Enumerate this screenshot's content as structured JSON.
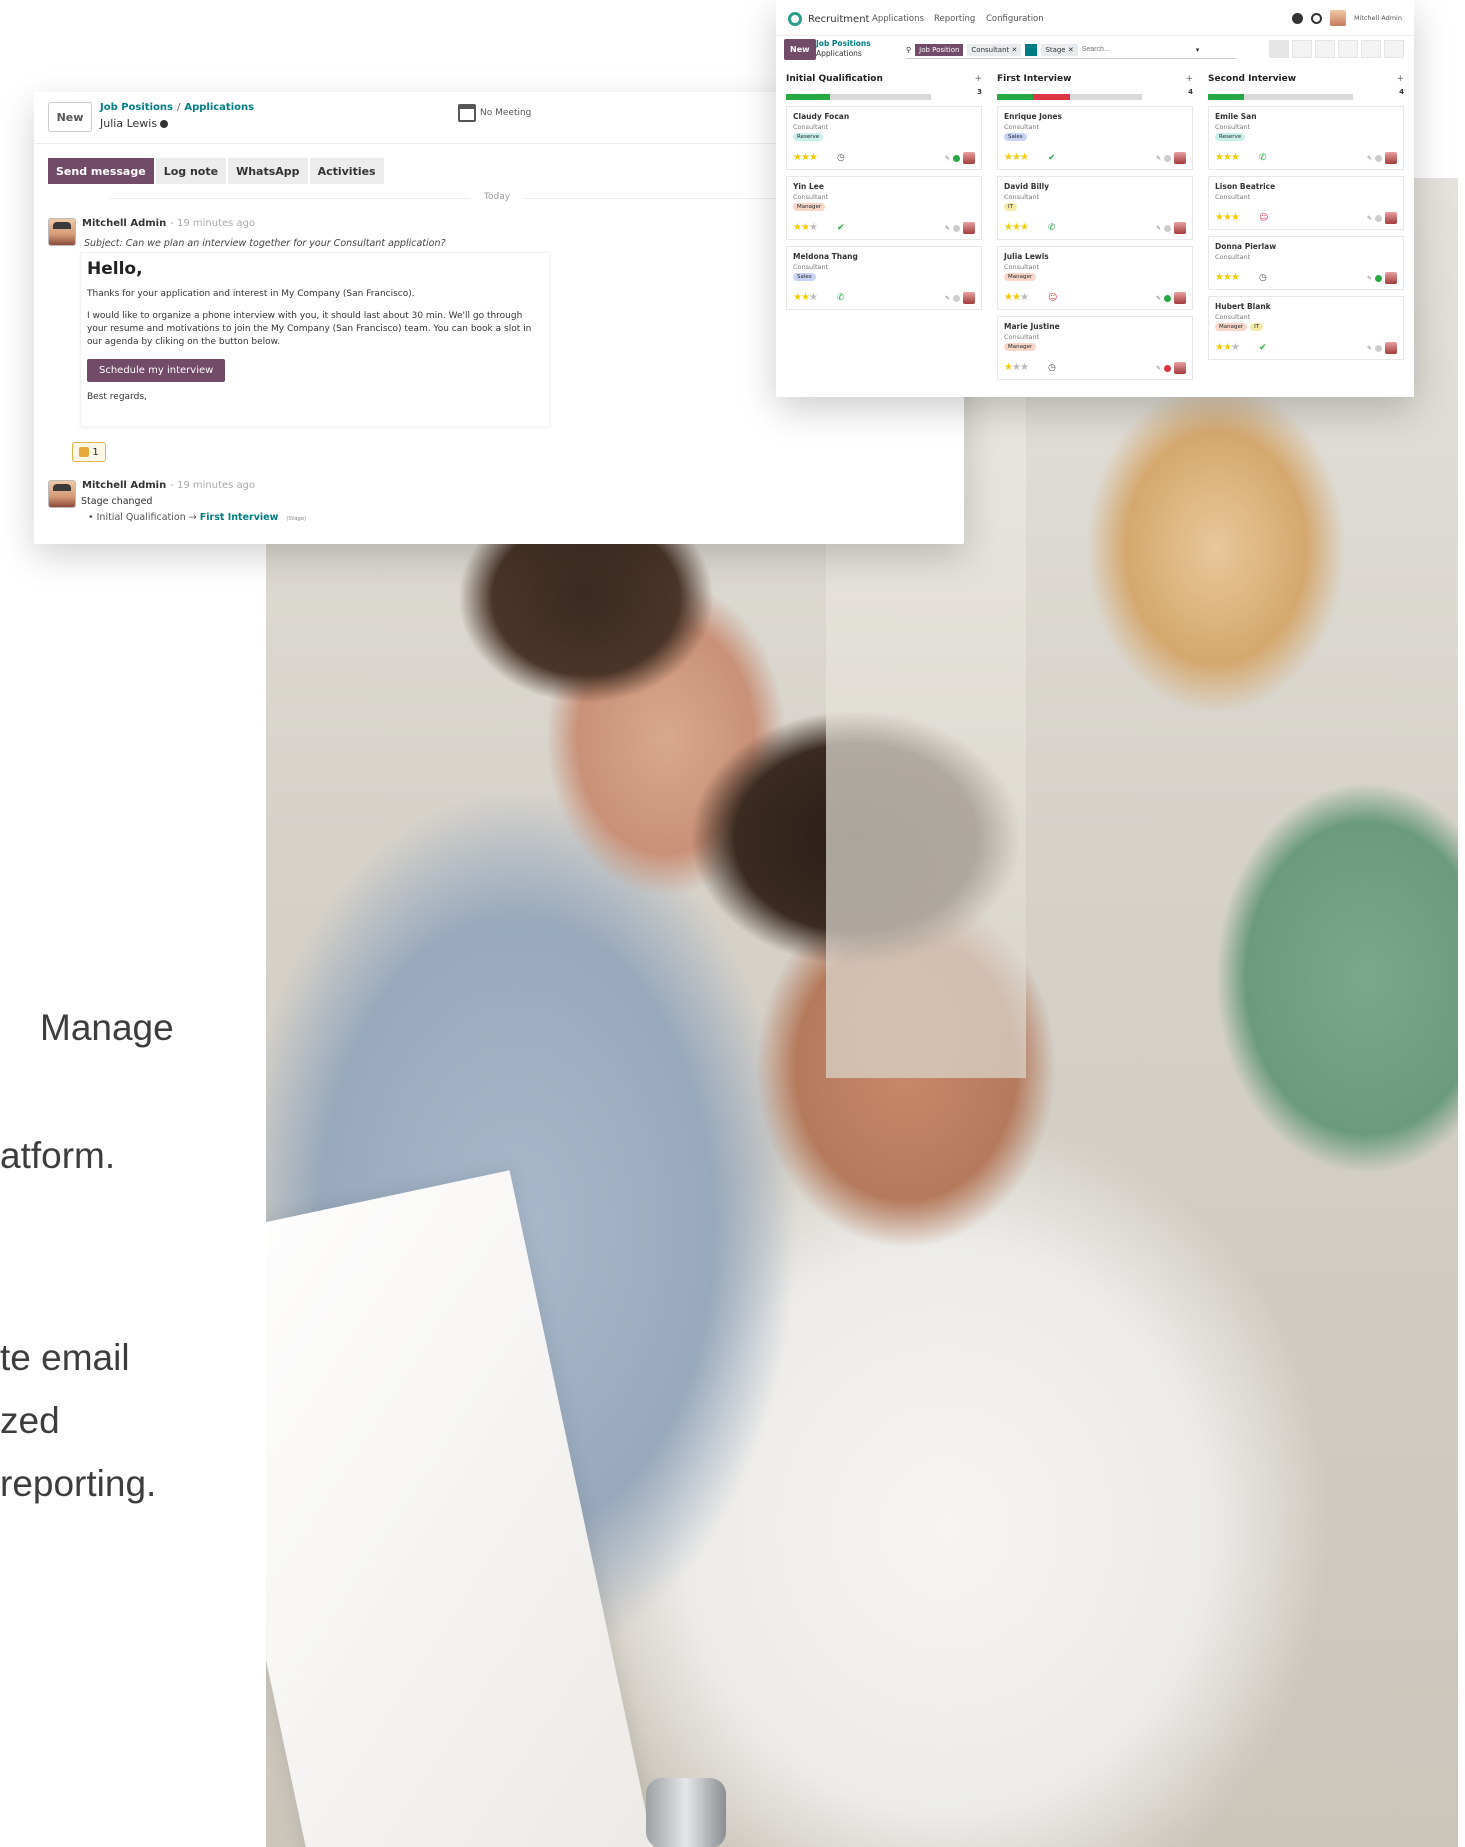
{
  "side_text": [
    "Manage",
    "atform.",
    "te email",
    "zed",
    "reporting."
  ],
  "chatter": {
    "new_label": "New",
    "breadcrumb_parent": "Job Positions",
    "breadcrumb_sep": "/",
    "breadcrumb_current": "Applications",
    "record_name": "Julia Lewis",
    "meeting_label": "No Meeting",
    "actions": [
      "Send message",
      "Log note",
      "WhatsApp",
      "Activities"
    ],
    "separator": "Today",
    "message1": {
      "author": "Mitchell Admin",
      "time": "- 19 minutes ago",
      "subject": "Subject: Can we plan an interview together for your Consultant application?",
      "greeting": "Hello,",
      "para1": "Thanks for your application and interest in My Company (San Francisco).",
      "para2": "I would like to organize a phone interview with you, it should last about 30 min. We'll go through your resume and motivations to join the My Company (San Francisco) team. You can book a slot in our agenda by cliking on the button below.",
      "button": "Schedule my interview",
      "closing": "Best regards,"
    },
    "reaction_count": "1",
    "message2": {
      "author": "Mitchell Admin",
      "time": "- 19 minutes ago",
      "text": "Stage changed",
      "from": "Initial Qualification",
      "arrow": "→",
      "to": "First Interview",
      "field": "(Stage)"
    }
  },
  "kanban": {
    "app_name": "Recruitment",
    "menu": [
      "Applications",
      "Reporting",
      "Configuration"
    ],
    "user": "Mitchell Admin",
    "new_label": "New",
    "breadcrumb_parent": "Job Positions",
    "breadcrumb_current": "Applications",
    "facets": [
      "Job Position",
      "Consultant",
      "Stage"
    ],
    "search_placeholder": "Search...",
    "columns": [
      {
        "title": "Initial Qualification",
        "count": "3",
        "progress_green": 0.3,
        "progress_red": 0,
        "cards": [
          {
            "name": "Claudy Focan",
            "role": "Consultant",
            "tags": [
              {
                "label": "Reserve",
                "color": "#c9f0ea"
              }
            ],
            "stars": 3,
            "status": "#28a745"
          },
          {
            "name": "Yin Lee",
            "role": "Consultant",
            "tags": [
              {
                "label": "Manager",
                "color": "#f8d7c9"
              }
            ],
            "stars": 2,
            "status": "#cccccc"
          },
          {
            "name": "Meldona Thang",
            "role": "Consultant",
            "tags": [
              {
                "label": "Sales",
                "color": "#c9d4f8"
              }
            ],
            "stars": 2,
            "status": "#cccccc"
          }
        ]
      },
      {
        "title": "First Interview",
        "count": "4",
        "progress_green": 0.25,
        "progress_red": 0.25,
        "cards": [
          {
            "name": "Enrique Jones",
            "role": "Consultant",
            "tags": [
              {
                "label": "Sales",
                "color": "#c9d4f8"
              }
            ],
            "stars": 3,
            "status": "#cccccc"
          },
          {
            "name": "David Billy",
            "role": "Consultant",
            "tags": [
              {
                "label": "IT",
                "color": "#f3e9a8"
              }
            ],
            "stars": 3,
            "status": "#cccccc"
          },
          {
            "name": "Julia Lewis",
            "role": "Consultant",
            "tags": [
              {
                "label": "Manager",
                "color": "#f8d7c9"
              }
            ],
            "stars": 2,
            "status": "#28a745"
          },
          {
            "name": "Marie Justine",
            "role": "Consultant",
            "tags": [
              {
                "label": "Manager",
                "color": "#f8d7c9"
              }
            ],
            "stars": 1,
            "status": "#dc3545"
          }
        ]
      },
      {
        "title": "Second Interview",
        "count": "4",
        "progress_green": 0.25,
        "progress_red": 0,
        "cards": [
          {
            "name": "Emile San",
            "role": "Consultant",
            "tags": [
              {
                "label": "Reserve",
                "color": "#c9f0ea"
              }
            ],
            "stars": 3,
            "status": "#cccccc"
          },
          {
            "name": "Lison Beatrice",
            "role": "Consultant",
            "tags": [],
            "stars": 3,
            "status": "#cccccc"
          },
          {
            "name": "Donna Pierlaw",
            "role": "Consultant",
            "tags": [],
            "stars": 3,
            "status": "#28a745"
          },
          {
            "name": "Hubert Blank",
            "role": "Consultant",
            "tags": [
              {
                "label": "Manager",
                "color": "#f8d7c9"
              },
              {
                "label": "IT",
                "color": "#f3e9a8"
              }
            ],
            "stars": 2,
            "status": "#cccccc"
          }
        ]
      }
    ]
  }
}
